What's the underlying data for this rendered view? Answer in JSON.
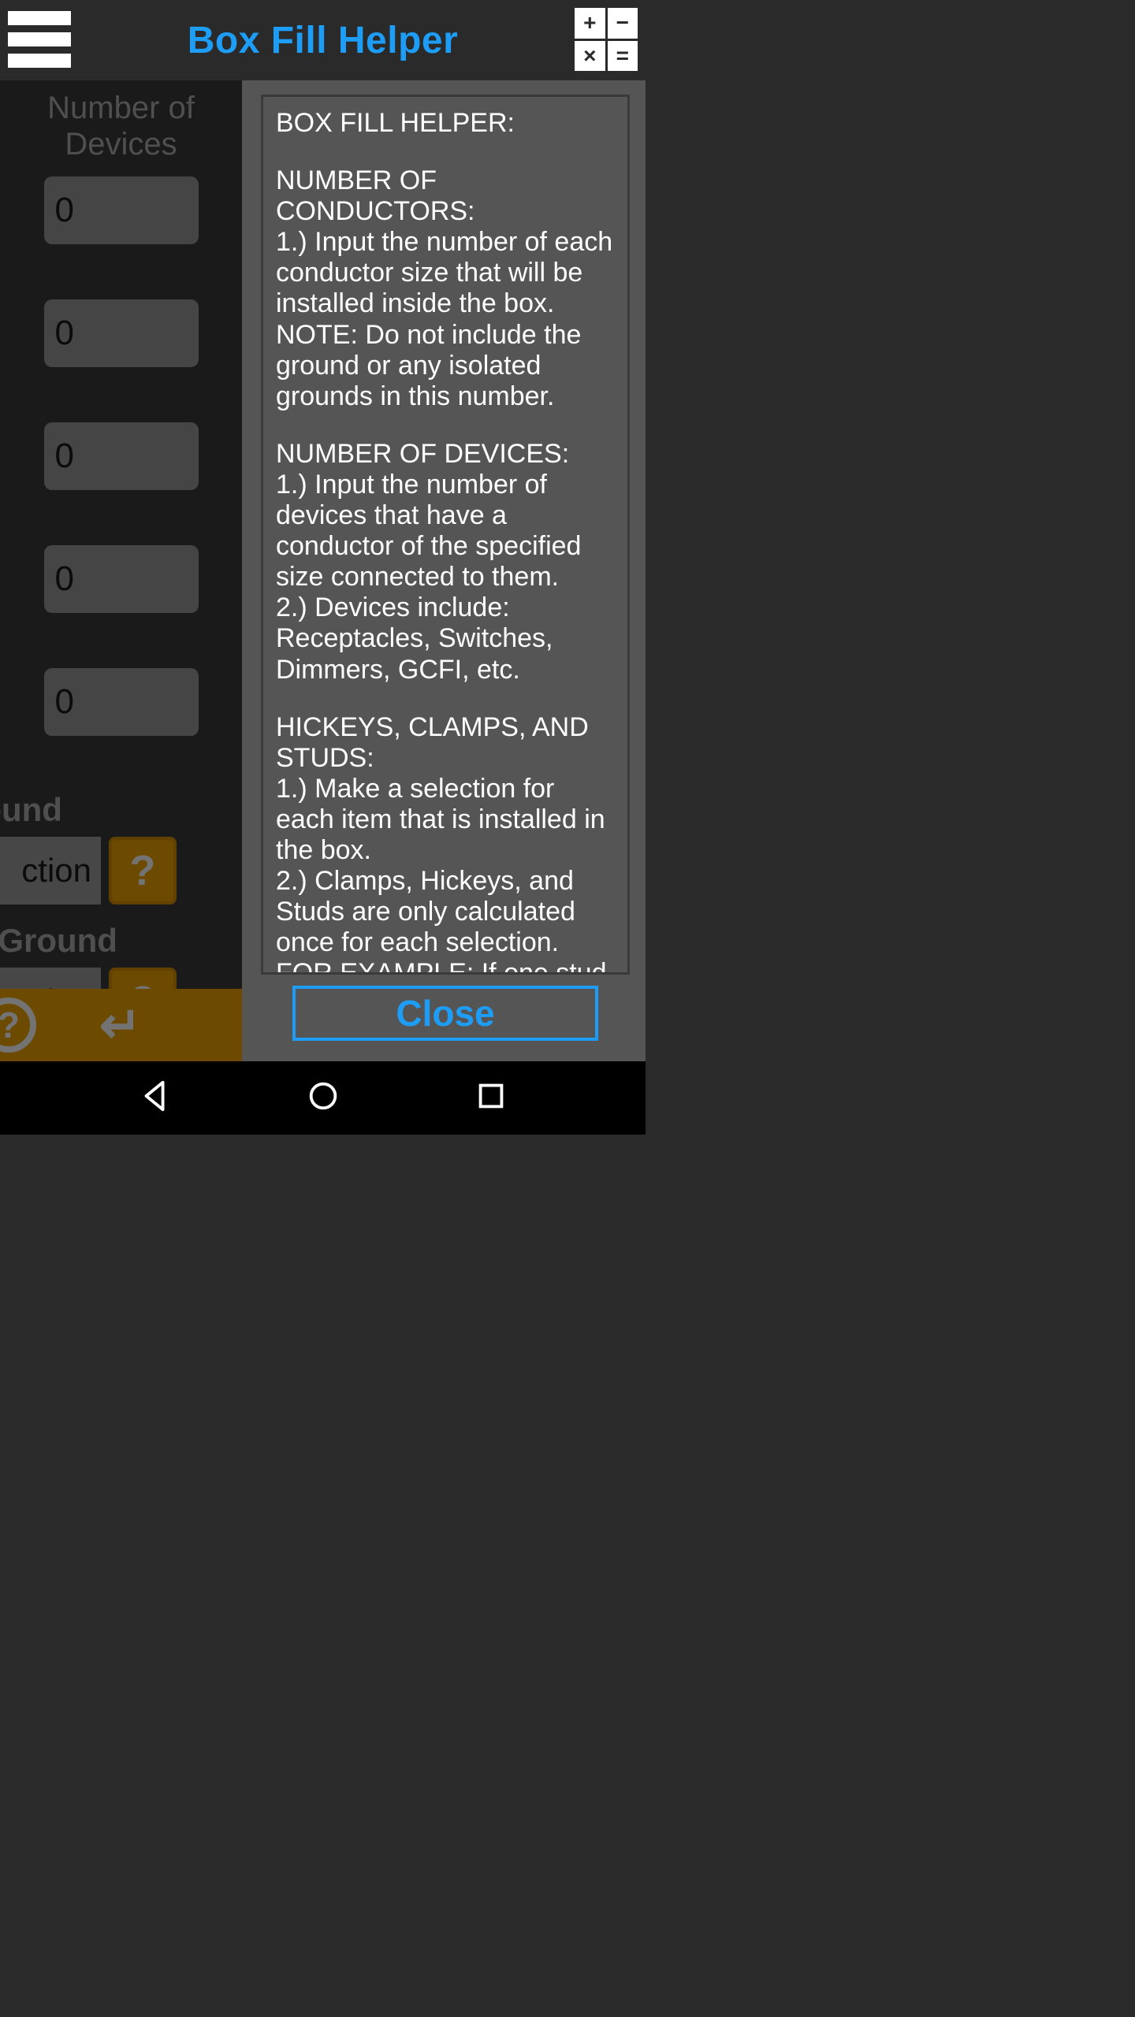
{
  "header": {
    "title": "Box Fill Helper",
    "calc_keys": [
      "+",
      "−",
      "×",
      "="
    ]
  },
  "sidebar": {
    "heading": "Number of Devices",
    "inputs": [
      "0",
      "0",
      "0",
      "0",
      "0"
    ],
    "labels": {
      "ground": "round",
      "isolated_ground": "d Ground"
    },
    "select_text": "ction",
    "help_glyph": "?"
  },
  "help": {
    "title_line": "BOX FILL HELPER:",
    "sections": [
      {
        "heading": "NUMBER OF CONDUCTORS:",
        "body": "1.) Input the number of each conductor size that will be installed inside the box.\nNOTE: Do not include the ground or any isolated grounds in this number."
      },
      {
        "heading": "NUMBER OF DEVICES:",
        "body": "1.) Input the number of devices that have a conductor of the specified size connected to them.\n2.) Devices include: Receptacles, Switches, Dimmers, GCFI, etc."
      },
      {
        "heading": "HICKEYS, CLAMPS, AND STUDS:",
        "body": "1.) Make a selection for each item that is installed in the box.\n2.) Clamps, Hickeys, and Studs are only calculated once for each selection.\nFOR EXAMPLE: If one stud, two clamps, and two hickeys are installed in the box, then"
      }
    ],
    "close_label": "Close"
  }
}
